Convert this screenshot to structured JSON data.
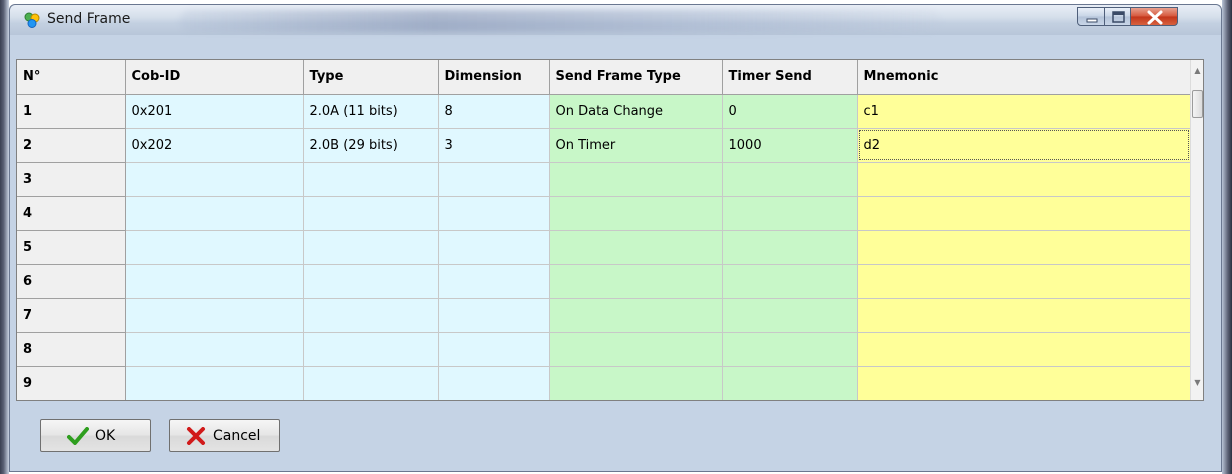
{
  "window": {
    "title": "Send Frame"
  },
  "grid": {
    "columns": [
      "N°",
      "Cob-ID",
      "Type",
      "Dimension",
      "Send Frame Type",
      "Timer Send",
      "Mnemonic"
    ],
    "rows": [
      {
        "n": "1",
        "cob_id": "0x201",
        "type": "2.0A (11 bits)",
        "dimension": "8",
        "send_frame_type": "On Data Change",
        "timer_send": "0",
        "mnemonic": "c1"
      },
      {
        "n": "2",
        "cob_id": "0x202",
        "type": "2.0B (29 bits)",
        "dimension": "3",
        "send_frame_type": "On Timer",
        "timer_send": "1000",
        "mnemonic": "d2"
      },
      {
        "n": "3",
        "cob_id": "",
        "type": "",
        "dimension": "",
        "send_frame_type": "",
        "timer_send": "",
        "mnemonic": ""
      },
      {
        "n": "4",
        "cob_id": "",
        "type": "",
        "dimension": "",
        "send_frame_type": "",
        "timer_send": "",
        "mnemonic": ""
      },
      {
        "n": "5",
        "cob_id": "",
        "type": "",
        "dimension": "",
        "send_frame_type": "",
        "timer_send": "",
        "mnemonic": ""
      },
      {
        "n": "6",
        "cob_id": "",
        "type": "",
        "dimension": "",
        "send_frame_type": "",
        "timer_send": "",
        "mnemonic": ""
      },
      {
        "n": "7",
        "cob_id": "",
        "type": "",
        "dimension": "",
        "send_frame_type": "",
        "timer_send": "",
        "mnemonic": ""
      },
      {
        "n": "8",
        "cob_id": "",
        "type": "",
        "dimension": "",
        "send_frame_type": "",
        "timer_send": "",
        "mnemonic": ""
      },
      {
        "n": "9",
        "cob_id": "",
        "type": "",
        "dimension": "",
        "send_frame_type": "",
        "timer_send": "",
        "mnemonic": ""
      }
    ]
  },
  "buttons": {
    "ok_label": "OK",
    "cancel_label": "Cancel"
  },
  "icons": {
    "app": "app-icon",
    "ok": "checkmark-icon",
    "cancel": "red-x-icon",
    "minimize": "minimize-icon",
    "maximize": "maximize-icon",
    "close": "close-icon"
  },
  "colors": {
    "id_columns_bg": "#e0f8ff",
    "timing_columns_bg": "#c8f7c8",
    "mnemonic_column_bg": "#ffff99",
    "header_bg": "#f0f0f0",
    "close_button": "#c2341a"
  }
}
